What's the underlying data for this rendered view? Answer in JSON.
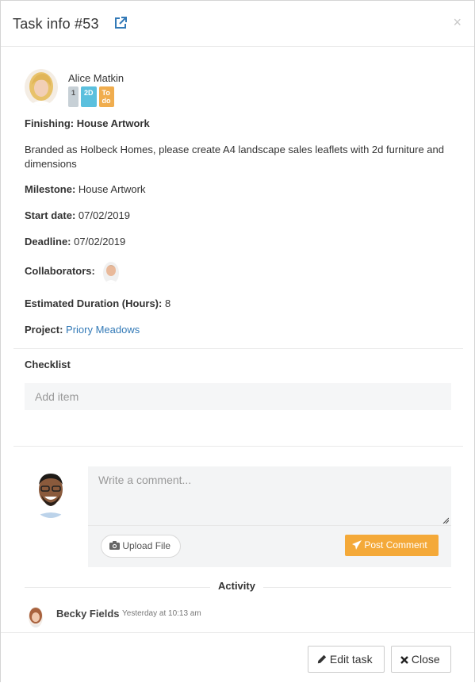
{
  "header": {
    "title": "Task info #53",
    "close_glyph": "×"
  },
  "task": {
    "assignee": "Alice Matkin",
    "badges": [
      "1",
      "2D",
      "To do"
    ],
    "heading": "Finishing: House Artwork",
    "description": "Branded as Holbeck Homes, please create A4 landscape sales leaflets with 2d furniture and dimensions",
    "milestone_label": "Milestone:",
    "milestone": "House Artwork",
    "start_label": "Start date:",
    "start_date": "07/02/2019",
    "deadline_label": "Deadline:",
    "deadline": "07/02/2019",
    "collaborators_label": "Collaborators:",
    "duration_label": "Estimated Duration (Hours):",
    "duration": "8",
    "project_label": "Project:",
    "project": "Priory Meadows"
  },
  "checklist": {
    "title": "Checklist",
    "placeholder": "Add item"
  },
  "comment": {
    "placeholder": "Write a comment...",
    "upload_label": "Upload File",
    "post_label": "Post Comment"
  },
  "activity": {
    "title": "Activity",
    "entries": [
      {
        "name": "Becky Fields",
        "time": "Yesterday at 10:13 am"
      }
    ]
  },
  "footer": {
    "edit_label": "Edit task",
    "close_label": "Close"
  },
  "colors": {
    "link": "#337ab7",
    "post_button": "#f4a939",
    "badge_blue": "#5bc0de",
    "badge_orange": "#f0ad4e"
  },
  "icons": [
    "external-link-icon",
    "close-icon",
    "camera-icon",
    "paper-plane-icon",
    "pencil-icon",
    "times-icon"
  ]
}
